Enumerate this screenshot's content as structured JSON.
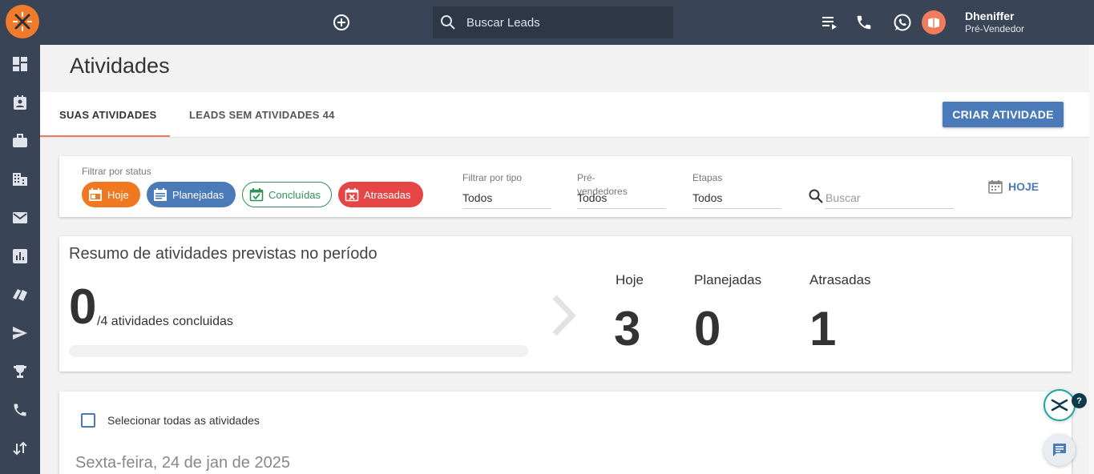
{
  "header": {
    "search_placeholder": "Buscar Leads",
    "user_name": "Dheniffer",
    "user_role": "Pré-Vendedor"
  },
  "sidebar": {
    "items": [
      {
        "icon": "dashboard-icon"
      },
      {
        "icon": "contacts-icon"
      },
      {
        "icon": "briefcase-icon"
      },
      {
        "icon": "building-icon"
      },
      {
        "icon": "mail-icon"
      },
      {
        "icon": "chart-icon"
      },
      {
        "icon": "tickets-icon"
      },
      {
        "icon": "send-icon"
      },
      {
        "icon": "trophy-icon"
      },
      {
        "icon": "phone-icon"
      },
      {
        "icon": "swap-icon"
      }
    ]
  },
  "page": {
    "title": "Atividades",
    "tabs": [
      {
        "label": "SUAS ATIVIDADES",
        "active": true
      },
      {
        "label": "LEADS SEM ATIVIDADES 44",
        "active": false
      }
    ],
    "create_button": "CRIAR ATIVIDADE"
  },
  "filters": {
    "status_label": "Filtrar por status",
    "chips": [
      {
        "label": "Hoje",
        "color": "#f07821"
      },
      {
        "label": "Planejadas",
        "color": "#4a7ab7"
      },
      {
        "label": "Concluídas",
        "color": "#2f8f5b"
      },
      {
        "label": "Atrasadas",
        "color": "#e64545"
      }
    ],
    "type_label": "Filtrar por tipo",
    "type_value": "Todos",
    "prevend_label_1": "Pré-",
    "prevend_label_2": "vendedores",
    "prevend_value": "Todos",
    "etapas_label": "Etapas",
    "etapas_value": "Todos",
    "search_placeholder": "Buscar",
    "today_button": "HOJE"
  },
  "summary": {
    "title": "Resumo de atividades previstas no período",
    "completed": "0",
    "completed_text": "/4 atividades concluidas",
    "progress_fraction": 0,
    "stats": [
      {
        "label": "Hoje",
        "value": "3"
      },
      {
        "label": "Planejadas",
        "value": "0"
      },
      {
        "label": "Atrasadas",
        "value": "1"
      }
    ]
  },
  "list": {
    "select_all": "Selecionar todas as atividades",
    "date_heading": "Sexta-feira, 24 de jan de 2025"
  },
  "colors": {
    "topbar": "#394456",
    "accent": "#f07c5b",
    "primary": "#4a7ab7"
  }
}
